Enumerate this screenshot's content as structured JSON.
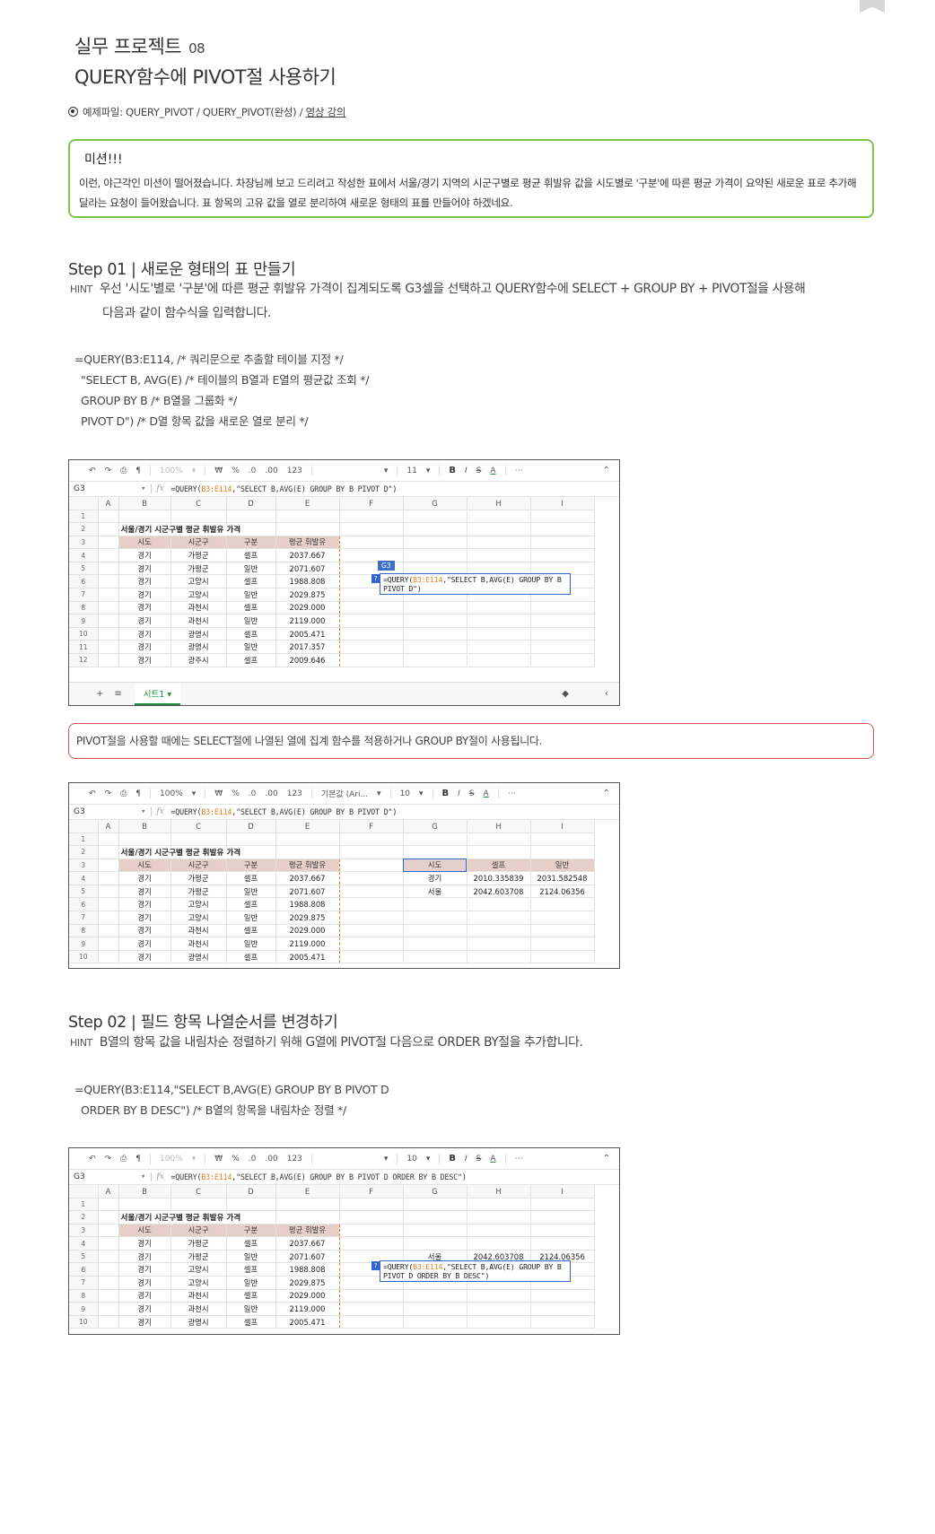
{
  "header": {
    "title1": "실무 프로젝트",
    "title1_num": "08",
    "title2": "QUERY함수에 PIVOT절 사용하기",
    "example_prefix": "예제파일: QUERY_PIVOT / QUERY_PIVOT(완성) / ",
    "example_link": "영상 강의"
  },
  "mission": {
    "title": "미션!!!",
    "body": "이런, 야근각인 미션이 떨어졌습니다. 차장님께 보고 드리려고 작성한 표에서 서울/경기 지역의 시군구별로 평균 휘발유 값을 시도별로 '구분'에 따른 평균 가격이 요약된 새로운 표로 추가해달라는 요청이 들어왔습니다. 표 항목의 고유 값을 열로 분리하여 새로운 형태의 표를 만들어야 하겠네요."
  },
  "step1": {
    "title": "Step 01 | 새로운 형태의 표 만들기",
    "hint_label": "HINT",
    "hint_line1": "우선 '시도'별로 '구분'에 따른 평균 휘발유 가격이 집계되도록 G3셀을 선택하고 QUERY함수에 SELECT + GROUP BY + PIVOT절을 사용해",
    "hint_line2": "다음과 같이 함수식을 입력합니다.",
    "code": [
      "=QUERY(B3:E114, /* 쿼리문으로 추출할 테이블 지정 */",
      "\"SELECT B, AVG(E) /* 테이블의 B열과 E열의 평균값 조회 */",
      "GROUP BY B /* B열을 그룹화 */",
      "PIVOT D\") /* D열 항목 값을 새로운 열로 분리 */"
    ]
  },
  "note": "PIVOT절을 사용할 때에는 SELECT절에 나열된 열에 집계 함수를 적용하거나 GROUP BY절이 사용됩니다.",
  "step2": {
    "title": "Step 02 | 필드 항목 나열순서를 변경하기",
    "hint_label": "HINT",
    "hint_line1": "B열의 항목 값을 내림차순 정렬하기 위해 G열에 PIVOT절 다음으로 ORDER BY절을 추가합니다.",
    "code": [
      "=QUERY(B3:E114,\"SELECT B,AVG(E) GROUP BY B PIVOT D",
      "ORDER BY B DESC\") /* B열의 항목을 내림차순 정렬 */"
    ]
  },
  "sheet": {
    "toolbar": {
      "zoom": "100%",
      "currency": "₩",
      "percent": "%",
      "dec0": ".0",
      "dec00": ".00",
      "fmt": "123",
      "font_default": "기본값 (Ari...",
      "font_size_a": "11",
      "font_size_b": "10",
      "bold": "B",
      "italic": "I",
      "strike": "S",
      "color": "A",
      "more": "⋯"
    },
    "cell_ref": "G3",
    "fx": "fx",
    "formula_a_prefix": "=QUERY(",
    "formula_a_ref": "B3:E114",
    "formula_a_rest": ",\"SELECT B,AVG(E) GROUP BY B PIVOT D\")",
    "formula_b_rest": ",\"SELECT B,AVG(E) GROUP BY B PIVOT D ORDER BY B DESC\")",
    "popup_a_line1_rest": ",\"SELECT B,AVG(E) GROUP BY B",
    "popup_a_line2": "PIVOT D\")",
    "popup_b_line2": "PIVOT D ORDER BY B DESC\")",
    "popup_q": "?",
    "g3_tag": "G3",
    "columns": [
      "A",
      "B",
      "C",
      "D",
      "E",
      "F",
      "G",
      "H",
      "I"
    ],
    "table_title": "서울/경기 시군구별 평균 휘발유 가격",
    "headers": [
      "시도",
      "시군구",
      "구분",
      "평균 휘발유"
    ],
    "rows": [
      [
        "경기",
        "가평군",
        "셀프",
        "2037.667"
      ],
      [
        "경기",
        "가평군",
        "일반",
        "2071.607"
      ],
      [
        "경기",
        "고양시",
        "셀프",
        "1988.808"
      ],
      [
        "경기",
        "고양시",
        "일반",
        "2029.875"
      ],
      [
        "경기",
        "과천시",
        "셀프",
        "2029.000"
      ],
      [
        "경기",
        "과천시",
        "일반",
        "2119.000"
      ],
      [
        "경기",
        "광명시",
        "셀프",
        "2005.471"
      ],
      [
        "경기",
        "광명시",
        "일반",
        "2017.357"
      ],
      [
        "경기",
        "광주시",
        "셀프",
        "2009.646"
      ]
    ],
    "pivot_headers": [
      "시도",
      "셀프",
      "일반"
    ],
    "pivot_rows": [
      [
        "경기",
        "2010.335839",
        "2031.582548"
      ],
      [
        "서울",
        "2042.603708",
        "2124.06356"
      ]
    ],
    "tab_add": "+",
    "tab_list": "≡",
    "tab_name": "시트1 ▾",
    "collapse": "‹"
  }
}
